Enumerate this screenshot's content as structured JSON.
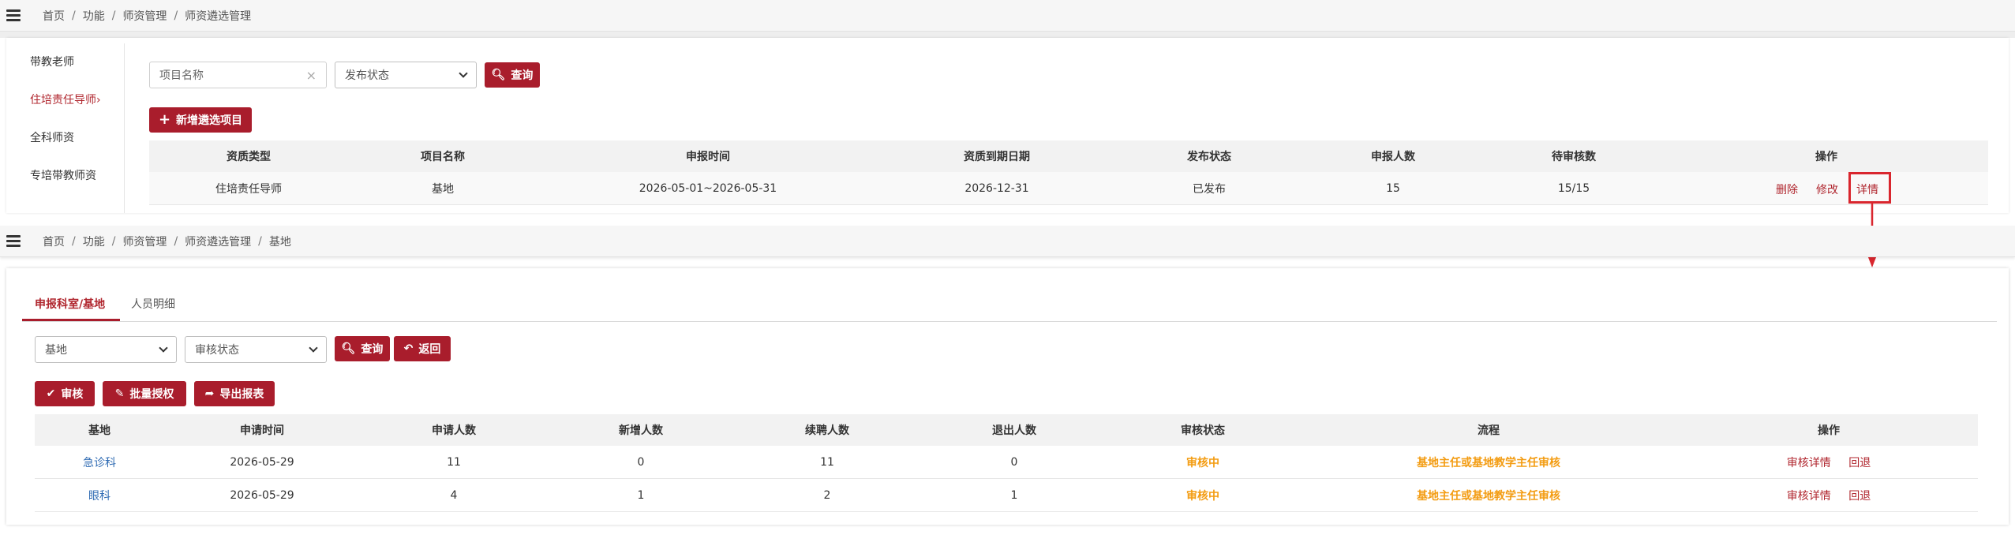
{
  "top": {
    "breadcrumb": [
      "首页",
      "功能",
      "师资管理",
      "师资遴选管理"
    ],
    "sidebar": [
      "带教老师",
      "住培责任导师›",
      "全科师资",
      "专培带教师资"
    ],
    "search": {
      "name_placeholder": "项目名称",
      "status_select": "发布状态",
      "query_label": "查询"
    },
    "add_button": "新增遴选项目",
    "table": {
      "headers": [
        "资质类型",
        "项目名称",
        "申报时间",
        "资质到期日期",
        "发布状态",
        "申报人数",
        "待审核数",
        "操作"
      ],
      "rows": [
        {
          "type": "住培责任导师",
          "name": "基地",
          "period": "2026-05-01~2026-05-31",
          "expiry": "2026-12-31",
          "status": "已发布",
          "applicants": "15",
          "pending": "15/15"
        }
      ],
      "actions": [
        "删除",
        "修改",
        "详情"
      ]
    }
  },
  "detail": {
    "breadcrumb": [
      "首页",
      "功能",
      "师资管理",
      "师资遴选管理",
      "基地"
    ],
    "tabs": [
      "申报科室/基地",
      "人员明细"
    ],
    "filters": {
      "base_select": "基地",
      "review_select": "审核状态",
      "query_label": "查询",
      "back_label": "返回"
    },
    "actions": {
      "review": "审核",
      "batch": "批量授权",
      "export": "导出报表"
    },
    "table": {
      "headers": [
        "基地",
        "申请时间",
        "申请人数",
        "新增人数",
        "续聘人数",
        "退出人数",
        "审核状态",
        "流程",
        "操作"
      ],
      "rows": [
        {
          "base": "急诊科",
          "date": "2026-05-29",
          "apply": "11",
          "new": "0",
          "renew": "11",
          "exit": "0",
          "status": "审核中",
          "flow": "基地主任或基地教学主任审核"
        },
        {
          "base": "眼科",
          "date": "2026-05-29",
          "apply": "4",
          "new": "1",
          "renew": "2",
          "exit": "1",
          "status": "审核中",
          "flow": "基地主任或基地教学主任审核"
        }
      ],
      "row_actions": [
        "审核详情",
        "回退"
      ]
    }
  },
  "colors": {
    "accent": "#a91d2c",
    "link": "#2f6bb3",
    "pending": "#f39c12",
    "highlight_box": "#d9262e"
  }
}
